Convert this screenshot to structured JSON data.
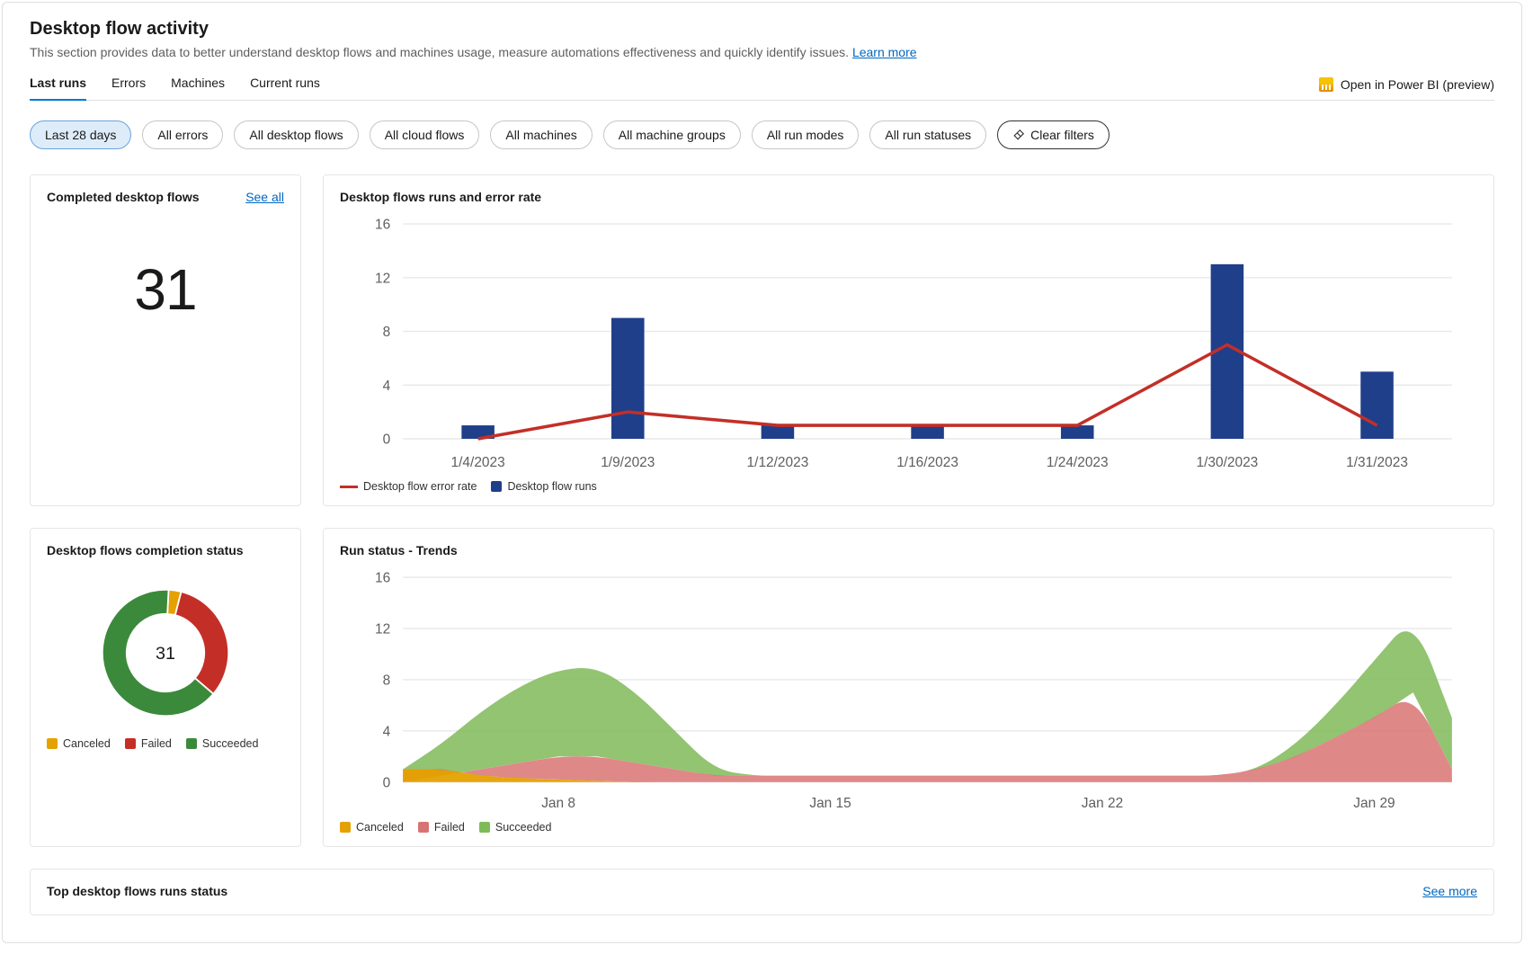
{
  "header": {
    "title": "Desktop flow activity",
    "description": "This section provides data to better understand desktop flows and machines usage, measure automations effectiveness and quickly identify issues.",
    "learn_more": "Learn more"
  },
  "tabs": {
    "items": [
      "Last runs",
      "Errors",
      "Machines",
      "Current runs"
    ],
    "active": 0,
    "open_pbi": "Open in Power BI (preview)"
  },
  "filters": {
    "chips": [
      "Last 28 days",
      "All errors",
      "All desktop flows",
      "All cloud flows",
      "All machines",
      "All machine groups",
      "All run modes",
      "All run statuses"
    ],
    "clear": "Clear filters"
  },
  "cards": {
    "completed": {
      "title": "Completed desktop flows",
      "see_all": "See all",
      "value": "31"
    },
    "runs_error": {
      "title": "Desktop flows runs and error rate",
      "legend_error": "Desktop flow error rate",
      "legend_runs": "Desktop flow runs"
    },
    "completion_status": {
      "title": "Desktop flows completion status",
      "center": "31",
      "legend_canceled": "Canceled",
      "legend_failed": "Failed",
      "legend_succeeded": "Succeeded"
    },
    "trends": {
      "title": "Run status - Trends",
      "legend_canceled": "Canceled",
      "legend_failed": "Failed",
      "legend_succeeded": "Succeeded"
    },
    "top": {
      "title": "Top desktop flows runs status",
      "see_more": "See more"
    }
  },
  "colors": {
    "blue_bar": "#1f3f8a",
    "red": "#c32f27",
    "green": "#3b8a3b",
    "green_fill": "#7fba58",
    "red_fill": "#d97373",
    "amber": "#e5a100"
  },
  "chart_data": [
    {
      "id": "runs_error",
      "type": "bar",
      "title": "Desktop flows runs and error rate",
      "xlabel": "",
      "ylabel": "",
      "ylim": [
        0,
        16
      ],
      "yticks": [
        0,
        4,
        8,
        12,
        16
      ],
      "categories": [
        "1/4/2023",
        "1/9/2023",
        "1/12/2023",
        "1/16/2023",
        "1/24/2023",
        "1/30/2023",
        "1/31/2023"
      ],
      "series": [
        {
          "name": "Desktop flow runs",
          "type": "bar",
          "color": "#1f3f8a",
          "values": [
            1,
            9,
            1,
            1,
            1,
            13,
            5
          ]
        },
        {
          "name": "Desktop flow error rate",
          "type": "line",
          "color": "#c32f27",
          "values": [
            0,
            2,
            1,
            1,
            1,
            7,
            1
          ]
        }
      ]
    },
    {
      "id": "completion_status",
      "type": "pie",
      "title": "Desktop flows completion status",
      "total": 31,
      "series": [
        {
          "name": "Canceled",
          "value": 1,
          "color": "#e5a100"
        },
        {
          "name": "Failed",
          "value": 10,
          "color": "#c32f27"
        },
        {
          "name": "Succeeded",
          "value": 20,
          "color": "#3b8a3b"
        }
      ]
    },
    {
      "id": "trends",
      "type": "area",
      "title": "Run status - Trends",
      "xlabel": "",
      "ylabel": "",
      "ylim": [
        0,
        16
      ],
      "yticks": [
        0,
        4,
        8,
        12,
        16
      ],
      "x": [
        "Jan 4",
        "Jan 5",
        "Jan 6",
        "Jan 7",
        "Jan 8",
        "Jan 9",
        "Jan 10",
        "Jan 11",
        "Jan 12",
        "Jan 13",
        "Jan 14",
        "Jan 15",
        "Jan 16",
        "Jan 17",
        "Jan 18",
        "Jan 19",
        "Jan 20",
        "Jan 21",
        "Jan 22",
        "Jan 23",
        "Jan 24",
        "Jan 25",
        "Jan 26",
        "Jan 27",
        "Jan 28",
        "Jan 29",
        "Jan 30",
        "Jan 31"
      ],
      "xticks": [
        "Jan 8",
        "Jan 15",
        "Jan 22",
        "Jan 29"
      ],
      "series": [
        {
          "name": "Canceled",
          "color": "#e5a100",
          "values": [
            1,
            1,
            0.5,
            0.3,
            0.2,
            0.1,
            0,
            0,
            0,
            0,
            0,
            0,
            0,
            0,
            0,
            0,
            0,
            0,
            0,
            0,
            0,
            0,
            0,
            0,
            0,
            0,
            0,
            0
          ]
        },
        {
          "name": "Failed",
          "color": "#d97373",
          "values": [
            0,
            0.5,
            1,
            1.5,
            2,
            2,
            1.5,
            1,
            0.5,
            0.5,
            0.5,
            0.5,
            0.5,
            0.5,
            0.5,
            0.5,
            0.5,
            0.5,
            0.5,
            0.5,
            0.5,
            0.5,
            1,
            2,
            3.5,
            5,
            7,
            1
          ]
        },
        {
          "name": "Succeeded",
          "color": "#7fba58",
          "values": [
            1,
            3,
            5.5,
            7.5,
            8.8,
            9,
            7,
            4,
            1,
            0.5,
            0.5,
            0.5,
            0.5,
            0.5,
            0.5,
            0.5,
            0.5,
            0.5,
            0.5,
            0.5,
            0.5,
            0.5,
            1,
            3,
            6,
            9.5,
            13,
            5
          ]
        }
      ]
    }
  ]
}
